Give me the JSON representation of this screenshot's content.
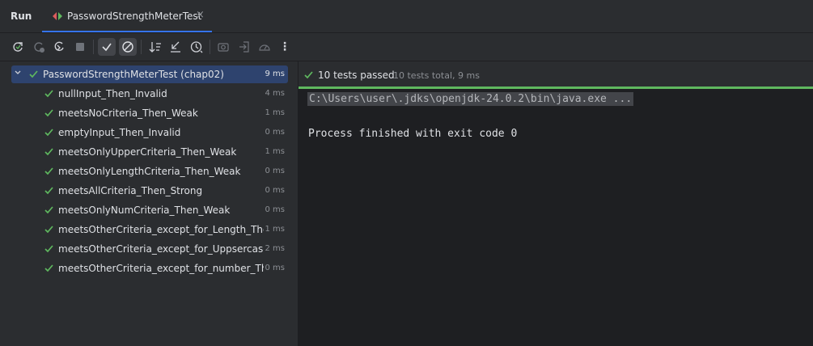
{
  "window": {
    "run_label": "Run",
    "tab_title": "PasswordStrengthMeterTest",
    "tab_close": "×"
  },
  "toolbar": {
    "buttons": [
      "rerun-icon",
      "rerun-failed-icon",
      "toggle-auto-test-icon",
      "stop-icon",
      "show-passed-icon",
      "show-ignored-icon",
      "sort-alphabetically-icon",
      "collapse-all-icon",
      "sort-by-duration-icon",
      "screenshot-icon",
      "import-tests-icon",
      "coverage-icon",
      "more-icon"
    ],
    "more_label": "⋮"
  },
  "tree": {
    "root": {
      "name": "PasswordStrengthMeterTest (chap02)",
      "time": "9 ms"
    },
    "tests": [
      {
        "name": "nullInput_Then_Invalid",
        "time": "4 ms"
      },
      {
        "name": "meetsNoCriteria_Then_Weak",
        "time": "1 ms"
      },
      {
        "name": "emptyInput_Then_Invalid",
        "time": "0 ms"
      },
      {
        "name": "meetsOnlyUpperCriteria_Then_Weak",
        "time": "1 ms"
      },
      {
        "name": "meetsOnlyLengthCriteria_Then_Weak",
        "time": "0 ms"
      },
      {
        "name": "meetsAllCriteria_Then_Strong",
        "time": "0 ms"
      },
      {
        "name": "meetsOnlyNumCriteria_Then_Weak",
        "time": "0 ms"
      },
      {
        "name": "meetsOtherCriteria_except_for_Length_Then_Normal",
        "time": "1 ms"
      },
      {
        "name": "meetsOtherCriteria_except_for_Uppsercase_Then_Normal",
        "time": "2 ms"
      },
      {
        "name": "meetsOtherCriteria_except_for_number_Then_Normal",
        "time": "0 ms"
      }
    ]
  },
  "console": {
    "passed": "10 tests passed",
    "total": "10 tests total, 9 ms",
    "command": "C:\\Users\\user\\.jdks\\openjdk-24.0.2\\bin\\java.exe ...",
    "exit": "Process finished with exit code 0",
    "progress": 1.0
  },
  "colors": {
    "accent": "#3574f0",
    "pass": "#5fb85f",
    "selection": "#2e436e"
  }
}
